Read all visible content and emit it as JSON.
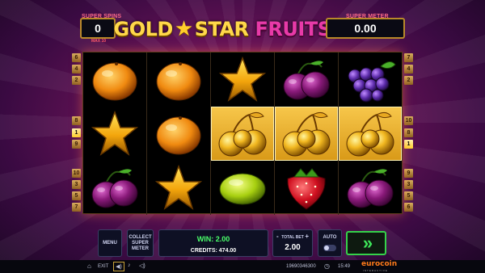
{
  "header": {
    "super_spins_label": "SUPER SPINS",
    "super_spins_value": "0",
    "max_label": "MAX 10",
    "super_meter_label": "SUPER METER",
    "super_meter_value": "0.00",
    "logo_part1": "GOLD",
    "logo_part2": "STAR",
    "logo_part3": "FRUITS"
  },
  "paylines": {
    "left": [
      "6",
      "4",
      "2",
      "8",
      "1",
      "9",
      "10",
      "3",
      "5",
      "7"
    ],
    "right": [
      "7",
      "4",
      "2",
      "10",
      "8",
      "1",
      "9",
      "3",
      "5",
      "6"
    ],
    "active": "1"
  },
  "reels": [
    [
      "orange",
      "star",
      "plum"
    ],
    [
      "orange",
      "orange",
      "star"
    ],
    [
      "star",
      "cherry",
      "lemon"
    ],
    [
      "plum",
      "cherry",
      "strawberry"
    ],
    [
      "grape",
      "cherry",
      "plum"
    ]
  ],
  "winning_row": 1,
  "controls": {
    "menu_label": "MENU",
    "collect_label": "COLLECT SUPER METER",
    "win_label": "WIN: 2.00",
    "credits_label": "CREDITS: 474.00",
    "total_bet_label": "TOTAL BET",
    "total_bet_value": "2.00",
    "bet_minus": "-",
    "bet_plus": "+",
    "auto_label": "AUTO",
    "spin_icon": "double-chevron-right"
  },
  "status": {
    "exit_label": "EXIT",
    "session_id": "19690346300",
    "time": "15:49",
    "brand": "eurocoin",
    "brand_sub": "INTERACTIVE"
  },
  "colors": {
    "accent_gold": "#d4a02a",
    "spin_green": "#35d24a",
    "win_highlight": "#f2b838"
  }
}
